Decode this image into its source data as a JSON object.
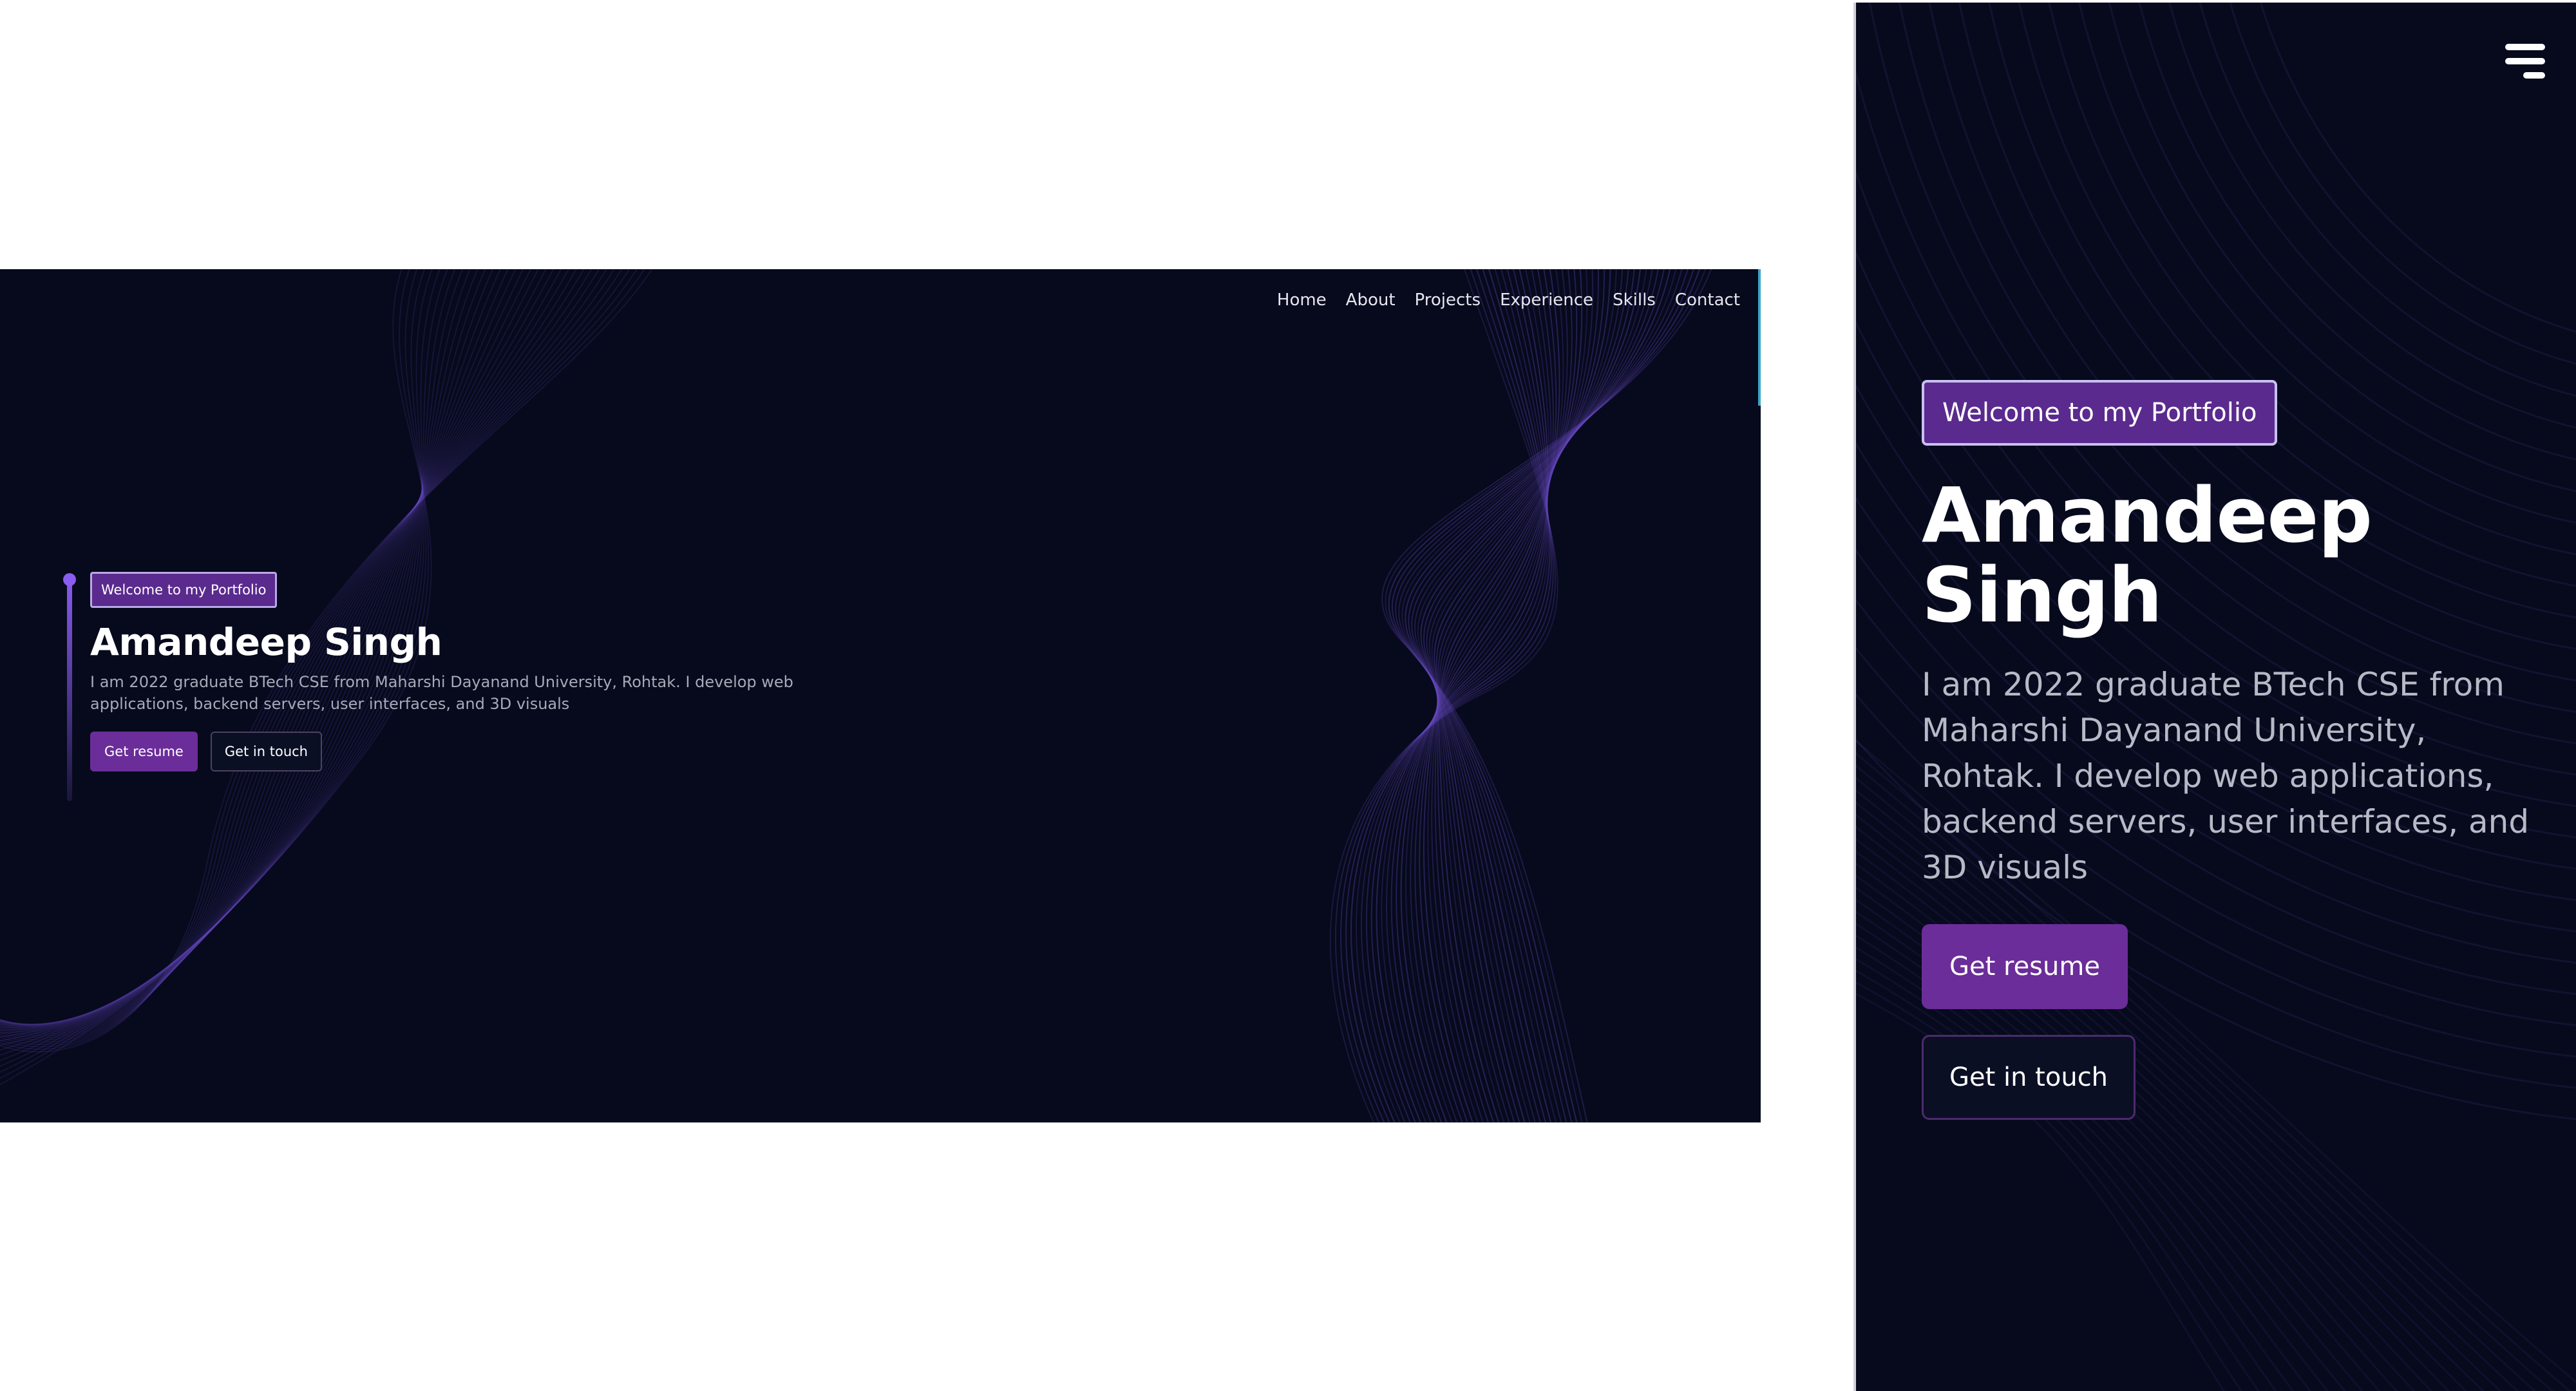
{
  "desktop": {
    "nav": [
      "Home",
      "About",
      "Projects",
      "Experience",
      "Skills",
      "Contact"
    ],
    "badge": "Welcome to my Portfolio",
    "name": "Amandeep Singh",
    "description": "I am 2022 graduate BTech CSE from Maharshi Dayanand University, Rohtak. I develop web applications, backend servers, user interfaces, and 3D visuals",
    "primary_button": "Get resume",
    "secondary_button": "Get in touch"
  },
  "mobile": {
    "menu_icon": "hamburger-menu-icon",
    "badge": "Welcome to my Portfolio",
    "name_line1": "Amandeep",
    "name_line2": "Singh",
    "description": "I am 2022 graduate BTech CSE from Maharshi Dayanand University, Rohtak. I develop web applications, backend servers, user interfaces, and 3D visuals",
    "primary_button": "Get resume",
    "secondary_button": "Get in touch"
  },
  "colors": {
    "background": "#060a1c",
    "accent": "#6b2d99",
    "wave": "#6a4bc4",
    "text": "#ffffff",
    "muted_text": "#a7a9b8"
  }
}
